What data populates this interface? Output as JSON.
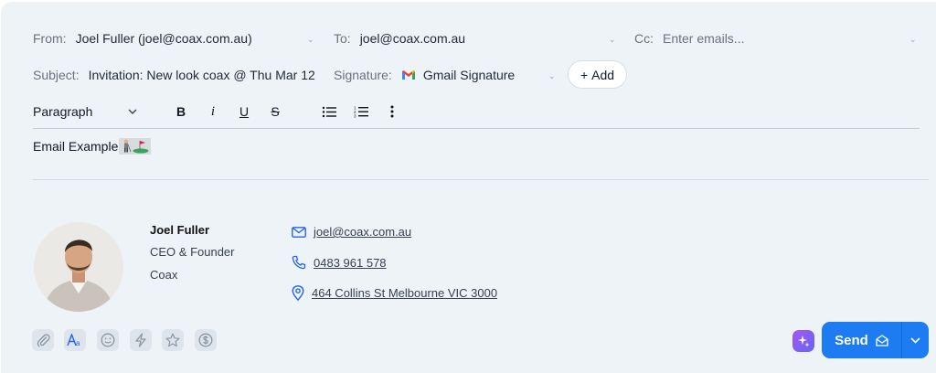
{
  "header": {
    "from_label": "From:",
    "from_value": "Joel Fuller (joel@coax.com.au)",
    "to_label": "To:",
    "to_value": "joel@coax.com.au",
    "cc_label": "Cc:",
    "cc_placeholder": "Enter emails...",
    "subject_label": "Subject:",
    "subject_value": "Invitation: New look coax @ Thu Mar 12",
    "signature_label": "Signature:",
    "signature_value": "Gmail Signature",
    "add_label": "Add"
  },
  "toolbar": {
    "paragraph": "Paragraph",
    "bold": "B",
    "italic": "i",
    "underline": "U",
    "strike": "S"
  },
  "body": {
    "text": "Email Example"
  },
  "signature": {
    "name": "Joel Fuller",
    "role": "CEO & Founder",
    "company": "Coax",
    "email": "joel@coax.com.au",
    "phone": "0483 961 578",
    "address": "464 Collins St Melbourne VIC 3000"
  },
  "footer": {
    "icons": [
      "paperclip-icon",
      "text-format-icon",
      "emoji-icon",
      "lightning-icon",
      "star-icon",
      "dollar-icon"
    ],
    "send_label": "Send"
  },
  "colors": {
    "accent": "#1d7cf2",
    "panel": "#eef3f8",
    "link_icon": "#2563eb"
  }
}
